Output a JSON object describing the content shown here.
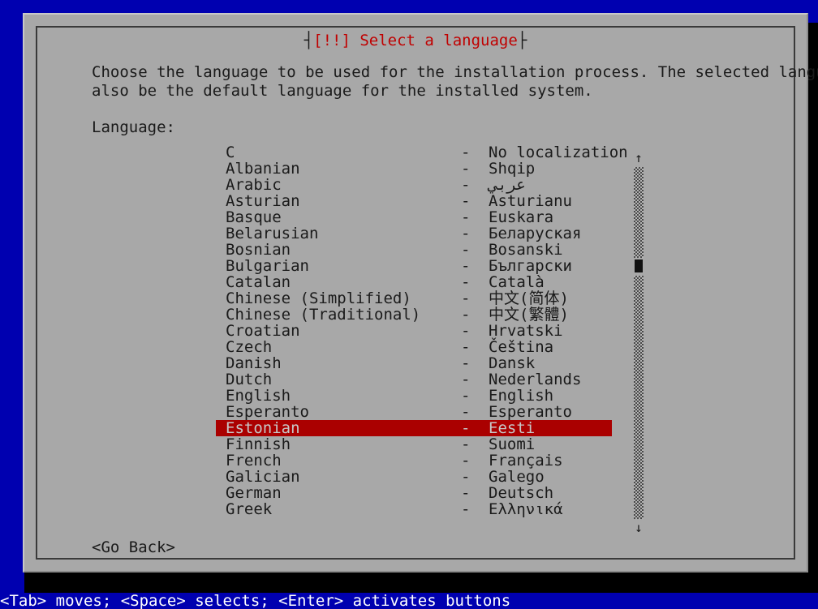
{
  "screen": {
    "background_color": "#0000b0",
    "dialog_background": "#a8a8a8",
    "accent_red": "#aa0000",
    "title_red": "#c00000",
    "text_color": "#1a1a1a"
  },
  "dialog": {
    "title_prefix": "[!!] ",
    "title": "Select a language",
    "title_full": "[!!] Select a language",
    "title_separator_left": "┤",
    "title_separator_right": "├",
    "description": "Choose the language to be used for the installation process. The selected language will\nalso be the default language for the installed system.",
    "field_label": "Language:"
  },
  "list": {
    "separator": "-",
    "selected_index": 17,
    "items": [
      {
        "name": "C",
        "native": "No localization"
      },
      {
        "name": "Albanian",
        "native": "Shqip"
      },
      {
        "name": "Arabic",
        "native": "عربي"
      },
      {
        "name": "Asturian",
        "native": "Asturianu"
      },
      {
        "name": "Basque",
        "native": "Euskara"
      },
      {
        "name": "Belarusian",
        "native": "Беларуская"
      },
      {
        "name": "Bosnian",
        "native": "Bosanski"
      },
      {
        "name": "Bulgarian",
        "native": "Български"
      },
      {
        "name": "Catalan",
        "native": "Català"
      },
      {
        "name": "Chinese (Simplified)",
        "native": "中文(简体)"
      },
      {
        "name": "Chinese (Traditional)",
        "native": "中文(繁體)"
      },
      {
        "name": "Croatian",
        "native": "Hrvatski"
      },
      {
        "name": "Czech",
        "native": "Čeština"
      },
      {
        "name": "Danish",
        "native": "Dansk"
      },
      {
        "name": "Dutch",
        "native": "Nederlands"
      },
      {
        "name": "English",
        "native": "English"
      },
      {
        "name": "Esperanto",
        "native": "Esperanto"
      },
      {
        "name": "Estonian",
        "native": "Eesti"
      },
      {
        "name": "Finnish",
        "native": "Suomi"
      },
      {
        "name": "French",
        "native": "Français"
      },
      {
        "name": "Galician",
        "native": "Galego"
      },
      {
        "name": "German",
        "native": "Deutsch"
      },
      {
        "name": "Greek",
        "native": "Ελληνικά"
      }
    ]
  },
  "scrollbar": {
    "up_arrow": "↑",
    "down_arrow": "↓"
  },
  "buttons": {
    "go_back": "<Go Back>"
  },
  "status_bar": {
    "text": "<Tab> moves; <Space> selects; <Enter> activates buttons"
  }
}
